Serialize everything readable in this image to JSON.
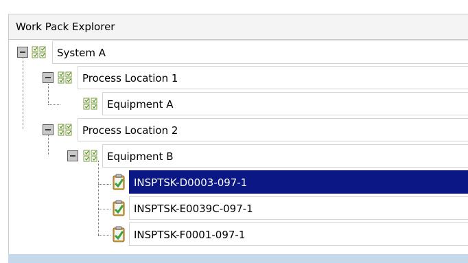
{
  "panel": {
    "title": "Work Pack Explorer"
  },
  "tree": {
    "nodes": [
      {
        "label": "System A",
        "icon": "workpack-group-icon",
        "expanded": true
      },
      {
        "label": "Process Location 1",
        "icon": "workpack-group-icon",
        "expanded": true
      },
      {
        "label": "Equipment A",
        "icon": "workpack-group-icon",
        "expanded": false
      },
      {
        "label": "Process Location 2",
        "icon": "workpack-group-icon",
        "expanded": true
      },
      {
        "label": "Equipment B",
        "icon": "workpack-group-icon",
        "expanded": true
      },
      {
        "label": "INSPTSK-D0003-097-1",
        "icon": "inspection-task-icon",
        "selected": true
      },
      {
        "label": "INSPTSK-E0039C-097-1",
        "icon": "inspection-task-icon",
        "selected": false
      },
      {
        "label": "INSPTSK-F0001-097-1",
        "icon": "inspection-task-icon",
        "selected": false
      }
    ]
  },
  "colors": {
    "selection": "#0a1784",
    "status_bar": "#c5d8ec",
    "task_icon_check": "#3aa23a"
  }
}
